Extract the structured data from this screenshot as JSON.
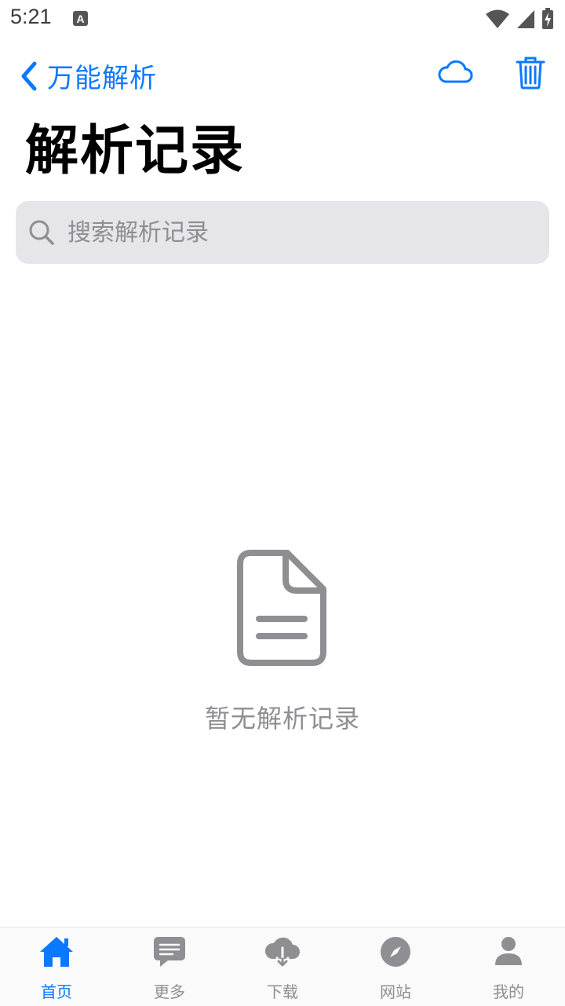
{
  "status": {
    "time": "5:21"
  },
  "nav": {
    "back_label": "万能解析",
    "back_icon": "chevron-left-icon",
    "cloud_icon": "cloud-icon",
    "trash_icon": "trash-icon",
    "accent": "#0a79ff"
  },
  "page": {
    "title": "解析记录"
  },
  "search": {
    "placeholder": "搜索解析记录",
    "value": ""
  },
  "empty_state": {
    "icon": "document-icon",
    "text": "暂无解析记录"
  },
  "tabs": [
    {
      "label": "首页",
      "icon": "home-icon",
      "active": true
    },
    {
      "label": "更多",
      "icon": "message-icon",
      "active": false
    },
    {
      "label": "下载",
      "icon": "cloud-download-icon",
      "active": false
    },
    {
      "label": "网站",
      "icon": "compass-icon",
      "active": false
    },
    {
      "label": "我的",
      "icon": "person-icon",
      "active": false
    }
  ]
}
